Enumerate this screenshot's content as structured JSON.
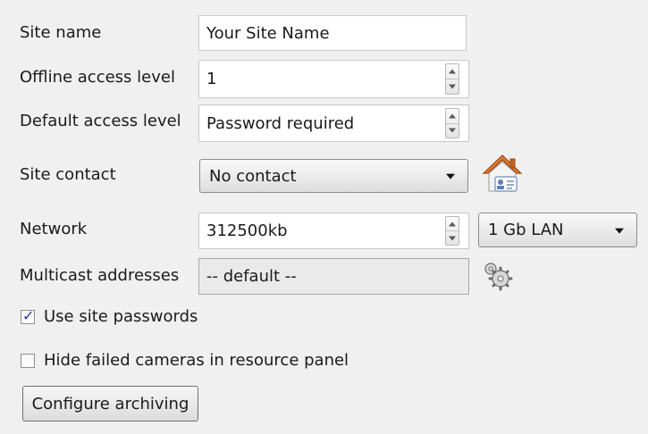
{
  "labels": {
    "site_name": "Site name",
    "offline_access": "Offline access level",
    "default_access": "Default access level",
    "site_contact": "Site contact",
    "network": "Network",
    "multicast": "Multicast addresses"
  },
  "fields": {
    "site_name_value": "Your Site Name",
    "offline_access_value": "1",
    "default_access_value": "Password required",
    "site_contact_value": "No contact",
    "network_value": "312500kb",
    "network_type_value": "1 Gb LAN",
    "multicast_value": "-- default --"
  },
  "checkboxes": [
    {
      "label": "Use site passwords",
      "checked": true
    },
    {
      "label": "Hide failed cameras in resource panel",
      "checked": false
    }
  ],
  "buttons": {
    "configure_archiving": "Configure archiving"
  },
  "icons": {
    "contact": "house-contact-icon",
    "multicast_settings": "gear-icon"
  },
  "colors": {
    "background": "#f0f0f0",
    "checkmark": "#2a3f9b",
    "house_roof": "#e07a2e"
  }
}
